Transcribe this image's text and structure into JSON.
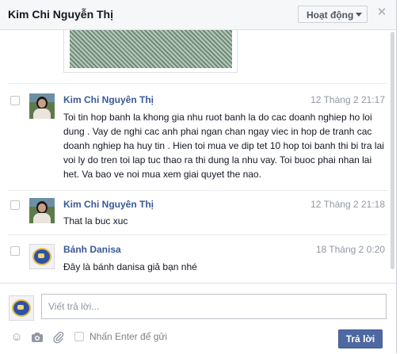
{
  "header": {
    "title": "Kim Chi Nguyễn Thị",
    "status_label": "Hoạt động",
    "close_glyph": "✕"
  },
  "messages": [
    {
      "sender": "Kim Chi Nguyên Thị",
      "time": "12 Tháng 2 21:17",
      "text": "Toi tin hop banh la khong gia nhu ruot banh la do cac doanh nghiep ho loi dung . Vay de nghi cac anh phai ngan chan ngay viec in hop de tranh cac doanh nghiep ha huy tin . Hien toi mua ve dip tet 10 hop toi banh thi bi tra lai voi ly do tren toi lap tuc thao ra thi dung la nhu vay. Toi buoc phai nhan lai het. Va bao ve noi mua xem giai quyet the nao.",
      "avatar": "person-avatar"
    },
    {
      "sender": "Kim Chi Nguyên Thị",
      "time": "12 Tháng 2 21:18",
      "text": "That la buc xuc",
      "avatar": "person-avatar"
    },
    {
      "sender": "Bánh Danisa",
      "time": "18 Tháng 2 0:20",
      "text": "Đây là bánh danisa giả bạn nhé",
      "avatar": "danisa-avatar"
    }
  ],
  "composer": {
    "placeholder": "Viết trả lời...",
    "enter_to_send_label": "Nhấn Enter để gửi",
    "send_label": "Trả lời",
    "icons": [
      "emoji-icon",
      "camera-icon",
      "attachment-icon"
    ]
  },
  "colors": {
    "sender": "#3b5998",
    "send_button": "#4e69a2",
    "timestamp": "#9197a3"
  }
}
